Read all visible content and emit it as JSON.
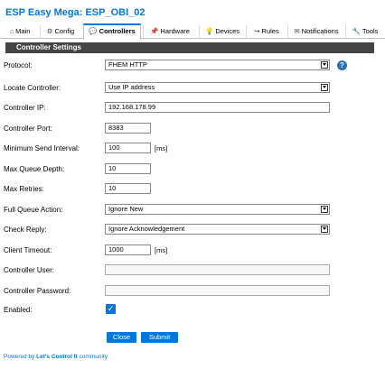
{
  "app": {
    "title": "ESP Easy Mega: ESP_OBI_02"
  },
  "tabs": [
    {
      "label": "Main",
      "icon": "home-icon",
      "glyph": "⌂"
    },
    {
      "label": "Config",
      "icon": "gear-icon",
      "glyph": "⚙"
    },
    {
      "label": "Controllers",
      "icon": "chat-icon",
      "glyph": "💬"
    },
    {
      "label": "Hardware",
      "icon": "pin-icon",
      "glyph": "📌"
    },
    {
      "label": "Devices",
      "icon": "bulb-icon",
      "glyph": "💡"
    },
    {
      "label": "Rules",
      "icon": "arrow-icon",
      "glyph": "↪"
    },
    {
      "label": "Notifications",
      "icon": "envelope-icon",
      "glyph": "✉"
    },
    {
      "label": "Tools",
      "icon": "wrench-icon",
      "glyph": "🔧"
    }
  ],
  "section": {
    "title": "Controller Settings"
  },
  "form": {
    "protocol": {
      "label": "Protocol:",
      "value": "FHEM HTTP",
      "help": "?"
    },
    "locate": {
      "label": "Locate Controller:",
      "value": "Use IP address"
    },
    "ip": {
      "label": "Controller IP:",
      "value": "192.168.178.99"
    },
    "port": {
      "label": "Controller Port:",
      "value": "8383"
    },
    "min_interval": {
      "label": "Minimum Send Interval:",
      "value": "100",
      "unit": "[ms]"
    },
    "queue_depth": {
      "label": "Max Queue Depth:",
      "value": "10"
    },
    "retries": {
      "label": "Max Retries:",
      "value": "10"
    },
    "full_queue": {
      "label": "Full Queue Action:",
      "value": "Ignore New"
    },
    "check_reply": {
      "label": "Check Reply:",
      "value": "Ignore Acknowledgement"
    },
    "timeout": {
      "label": "Client Timeout:",
      "value": "1000",
      "unit": "[ms]"
    },
    "user": {
      "label": "Controller User:",
      "value": ""
    },
    "password": {
      "label": "Controller Password:",
      "value": ""
    },
    "enabled": {
      "label": "Enabled:",
      "checked": true
    }
  },
  "buttons": {
    "close": "Close",
    "submit": "Submit"
  },
  "footer": {
    "prefix": "Powered by ",
    "brand": "Let's Control It",
    "suffix": " community"
  },
  "colors": {
    "accent": "#0077DD",
    "header_bg": "#444444"
  }
}
